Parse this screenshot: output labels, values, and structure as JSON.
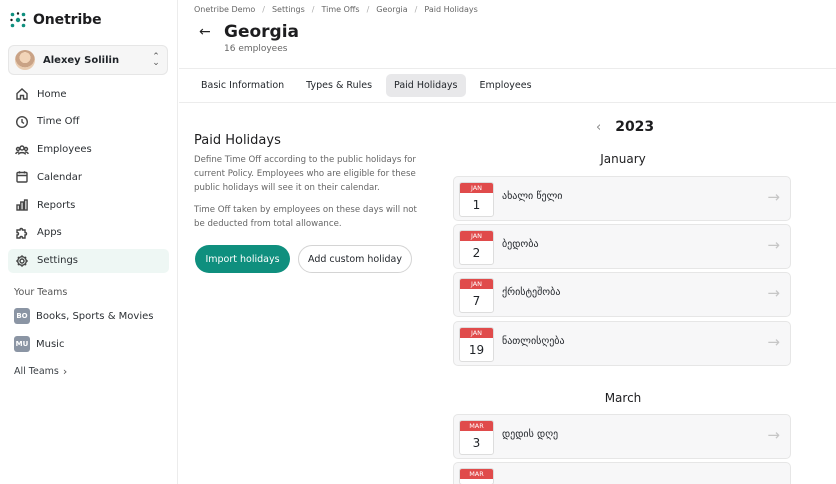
{
  "brand": {
    "name": "Onetribe"
  },
  "user": {
    "name": "Alexey Solilin"
  },
  "nav": [
    {
      "label": "Home",
      "icon": "home-icon"
    },
    {
      "label": "Time Off",
      "icon": "clock-icon"
    },
    {
      "label": "Employees",
      "icon": "people-icon"
    },
    {
      "label": "Calendar",
      "icon": "calendar-icon"
    },
    {
      "label": "Reports",
      "icon": "chart-icon"
    },
    {
      "label": "Apps",
      "icon": "puzzle-icon"
    },
    {
      "label": "Settings",
      "icon": "gear-icon",
      "active": true
    }
  ],
  "teams": {
    "title": "Your Teams",
    "items": [
      {
        "badge": "BO",
        "label": "Books, Sports & Movies"
      },
      {
        "badge": "MU",
        "label": "Music"
      }
    ],
    "all_label": "All Teams"
  },
  "breadcrumb": [
    "Onetribe Demo",
    "Settings",
    "Time Offs",
    "Georgia",
    "Paid Holidays"
  ],
  "page": {
    "title": "Georgia",
    "subtitle": "16 employees"
  },
  "tabs": [
    "Basic Information",
    "Types & Rules",
    "Paid Holidays",
    "Employees"
  ],
  "active_tab": "Paid Holidays",
  "paid_holidays": {
    "title": "Paid Holidays",
    "desc1": "Define Time Off according to the public holidays for current Policy. Employees who are eligible for these public holidays will see it on their calendar.",
    "desc2": "Time Off taken by employees on these days will not be deducted from total allowance.",
    "import_label": "Import holidays",
    "custom_label": "Add custom holiday"
  },
  "calendar": {
    "year": "2023",
    "months": [
      {
        "name": "January",
        "holidays": [
          {
            "month": "JAN",
            "day": "1",
            "name": "ახალი წელი"
          },
          {
            "month": "JAN",
            "day": "2",
            "name": "ბედობა"
          },
          {
            "month": "JAN",
            "day": "7",
            "name": "ქრისტეშობა"
          },
          {
            "month": "JAN",
            "day": "19",
            "name": "ნათლისღება"
          }
        ]
      },
      {
        "name": "March",
        "holidays": [
          {
            "month": "MAR",
            "day": "3",
            "name": "დედის დღე"
          },
          {
            "month": "MAR",
            "day": "",
            "name": ""
          }
        ]
      }
    ]
  },
  "colors": {
    "accent": "#0f8f7e",
    "calendar_red": "#e04b4b",
    "active_bg": "#eef7f4"
  }
}
